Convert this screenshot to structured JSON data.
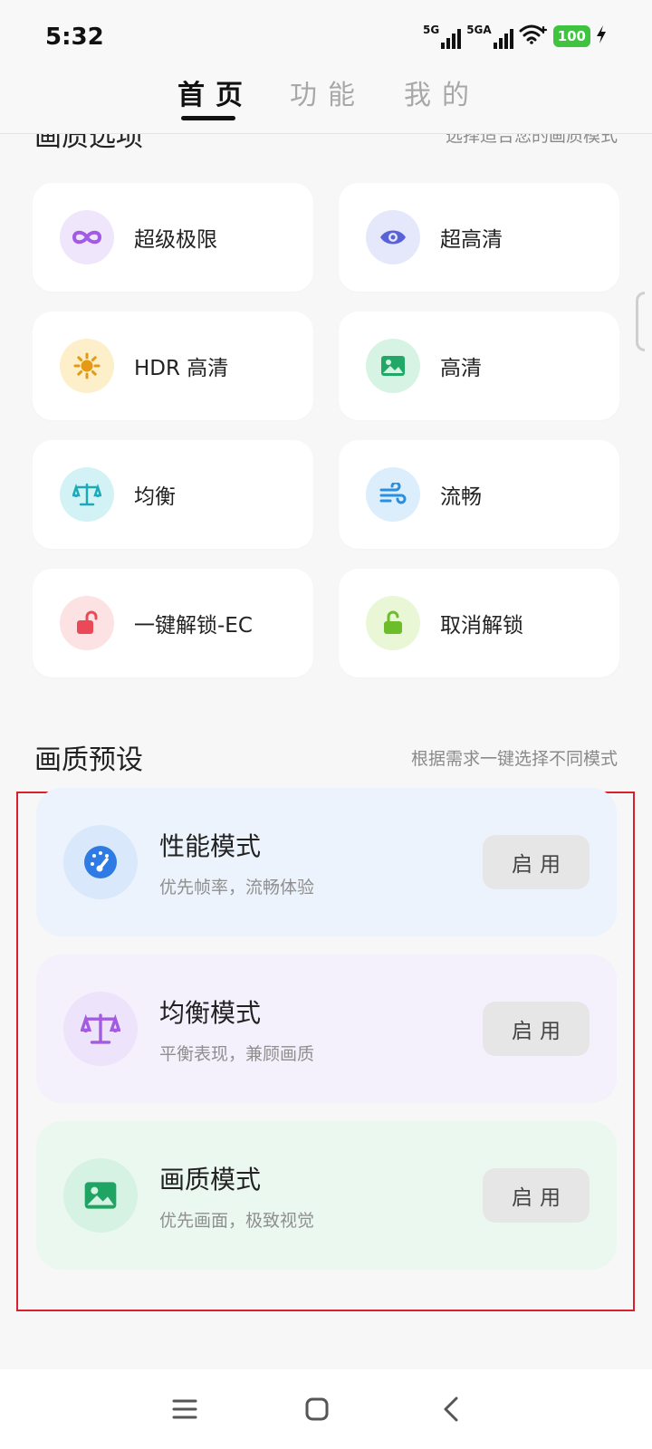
{
  "status": {
    "time": "5:32",
    "net1": "5G",
    "net2": "5GA",
    "battery": "100"
  },
  "tabs": [
    {
      "label": "首页",
      "active": true
    },
    {
      "label": "功能",
      "active": false
    },
    {
      "label": "我的",
      "active": false
    }
  ],
  "quality_options": {
    "title": "画质选项",
    "subtitle": "选择适合您的画质模式",
    "items": [
      {
        "label": "超级极限",
        "icon": "infinity-icon",
        "icon_bg": "#efe6fc",
        "icon_color": "#a25be6"
      },
      {
        "label": "超高清",
        "icon": "eye-icon",
        "icon_bg": "#e5e8fb",
        "icon_color": "#5a62d8"
      },
      {
        "label": "HDR 高清",
        "icon": "sun-icon",
        "icon_bg": "#fcefc9",
        "icon_color": "#e49a12"
      },
      {
        "label": "高清",
        "icon": "image-icon",
        "icon_bg": "#d6f3e3",
        "icon_color": "#22a866"
      },
      {
        "label": "均衡",
        "icon": "scale-icon",
        "icon_bg": "#d3f2f5",
        "icon_color": "#1aaab8"
      },
      {
        "label": "流畅",
        "icon": "wind-icon",
        "icon_bg": "#dcedfb",
        "icon_color": "#2b8fe0"
      },
      {
        "label": "一键解锁-EC",
        "icon": "unlock-icon",
        "icon_bg": "#fde2e4",
        "icon_color": "#ea4a58"
      },
      {
        "label": "取消解锁",
        "icon": "unlock-icon",
        "icon_bg": "#e9f7d6",
        "icon_color": "#6cbd2a"
      }
    ]
  },
  "presets": {
    "title": "画质预设",
    "subtitle": "根据需求一键选择不同模式",
    "items": [
      {
        "title": "性能模式",
        "desc": "优先帧率，流畅体验",
        "button": "启用",
        "icon": "speedometer-icon",
        "card_bg": "#ecf3fd",
        "icon_bg": "#d9e8fb",
        "icon_color": "#2f7be4"
      },
      {
        "title": "均衡模式",
        "desc": "平衡表现，兼顾画质",
        "button": "启用",
        "icon": "scale-icon",
        "card_bg": "#f4f0fc",
        "icon_bg": "#ede3fa",
        "icon_color": "#a35ce0"
      },
      {
        "title": "画质模式",
        "desc": "优先画面，极致视觉",
        "button": "启用",
        "icon": "image-icon",
        "card_bg": "#ebf8f0",
        "icon_bg": "#d6f2e2",
        "icon_color": "#1fa463"
      }
    ]
  },
  "navbar": {
    "menu_icon": "menu-icon",
    "home_icon": "home-square-icon",
    "back_icon": "back-chevron-icon"
  }
}
